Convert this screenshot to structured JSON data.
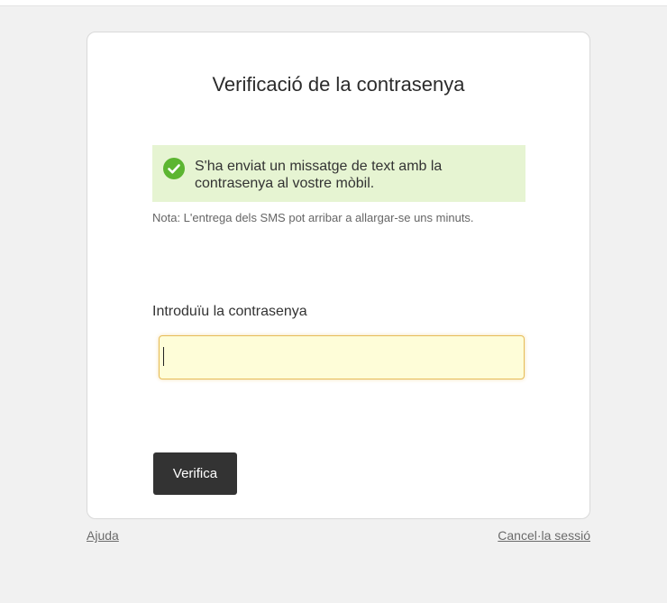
{
  "page": {
    "title": "Verificació de la contrasenya"
  },
  "alert": {
    "icon": "check-circle-icon",
    "color": "#5cb531",
    "background": "#e6f4d2",
    "message": "S'ha enviat un missatge de text amb la contrasenya al vostre mòbil."
  },
  "note": "Nota: L'entrega dels SMS pot arribar a allargar-se uns minuts.",
  "form": {
    "label": "Introduïu la contrasenya",
    "value": ""
  },
  "actions": {
    "verify_label": "Verifica"
  },
  "footer": {
    "help_label": "Ajuda",
    "signout_label": "Cancel·la sessió"
  }
}
